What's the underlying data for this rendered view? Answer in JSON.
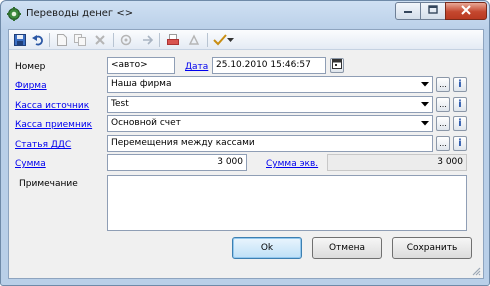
{
  "window": {
    "title": "Переводы денег <>",
    "controls": {
      "minimize": "minimize",
      "maximize": "maximize",
      "close": "close"
    }
  },
  "toolbar": {
    "icons": [
      "save-icon",
      "undo-icon",
      "new-icon",
      "copy-icon",
      "delete-icon",
      "refresh-icon",
      "move-icon",
      "print-icon",
      "post-icon",
      "check-icon"
    ]
  },
  "form": {
    "number": {
      "label": "Номер",
      "value": "<авто>"
    },
    "date": {
      "label": "Дата",
      "value": "25.10.2010 15:46:57"
    },
    "firm": {
      "label": "Фирма",
      "value": "Наша фирма"
    },
    "cash_from": {
      "label": "Касса источник",
      "value": "Test"
    },
    "cash_to": {
      "label": "Касса приемник",
      "value": "Основной счет"
    },
    "dds_item": {
      "label": "Статья ДДС",
      "value": "Перемещения между кассами"
    },
    "amount": {
      "label": "Сумма",
      "value": "3 000"
    },
    "amount_eq": {
      "label": "Сумма экв.",
      "value": "3 000"
    },
    "note": {
      "label": "Примечание",
      "value": ""
    }
  },
  "buttons": {
    "ok": "Ok",
    "cancel": "Отмена",
    "save": "Сохранить",
    "ellipsis": "...",
    "info": "i"
  },
  "colors": {
    "link": "#0000ee",
    "titlebar": "#b9cfe8",
    "close_button": "#c4472e",
    "default_button": "#bfe0f7"
  }
}
